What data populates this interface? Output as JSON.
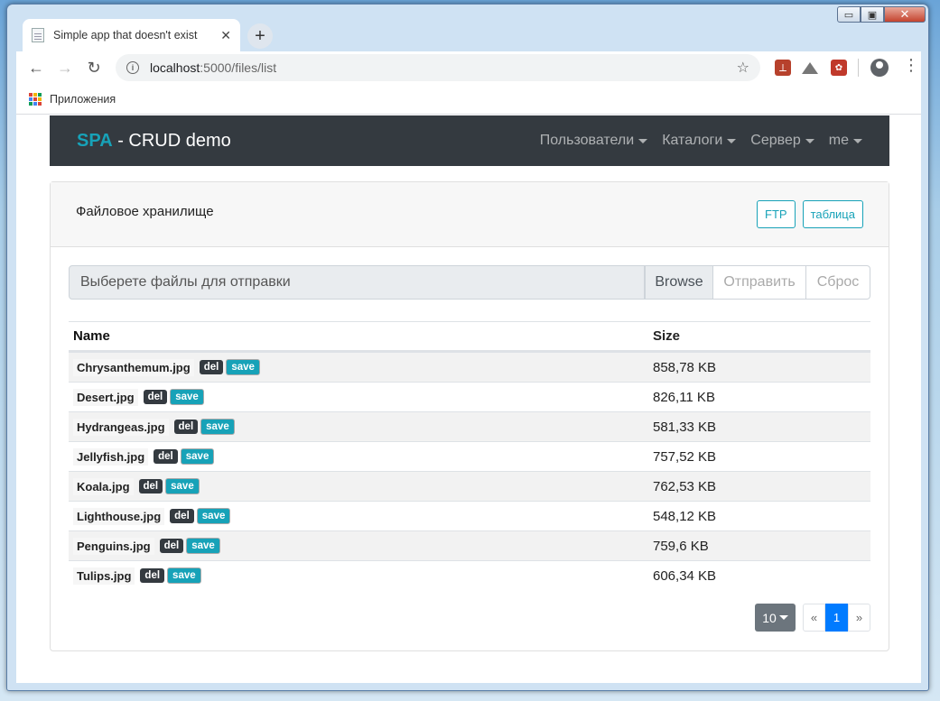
{
  "browser": {
    "tab_title": "Simple app that doesn't exist",
    "tab_close": "✕",
    "new_tab": "+",
    "url_host": "localhost",
    "url_path": ":5000/files/list",
    "bookmarks_apps": "Приложения"
  },
  "window": {
    "minimize": "▭",
    "maximize": "▣",
    "close": "✕"
  },
  "navbar": {
    "brand_spa": "SPA",
    "brand_rest": " - CRUD demo",
    "items": [
      "Пользователи",
      "Каталоги",
      "Сервер",
      "me"
    ]
  },
  "card": {
    "title": "Файловое хранилище",
    "ftp_button": "FTP",
    "table_button": "таблица"
  },
  "upload": {
    "placeholder": "Выберете файлы для отправки",
    "browse": "Browse",
    "send": "Отправить",
    "reset": "Сброс"
  },
  "table": {
    "headers": [
      "Name",
      "Size"
    ],
    "del_label": "del",
    "save_label": "save",
    "rows": [
      {
        "name": "Chrysanthemum.jpg",
        "size": "858,78 KB"
      },
      {
        "name": "Desert.jpg",
        "size": "826,11 KB"
      },
      {
        "name": "Hydrangeas.jpg",
        "size": "581,33 KB"
      },
      {
        "name": "Jellyfish.jpg",
        "size": "757,52 KB"
      },
      {
        "name": "Koala.jpg",
        "size": "762,53 KB"
      },
      {
        "name": "Lighthouse.jpg",
        "size": "548,12 KB"
      },
      {
        "name": "Penguins.jpg",
        "size": "759,6 KB"
      },
      {
        "name": "Tulips.jpg",
        "size": "606,34 KB"
      }
    ]
  },
  "pagination": {
    "page_size": "10",
    "prev": "«",
    "current": "1",
    "next": "»"
  },
  "colors": {
    "navbar_bg": "#343a40",
    "brand_accent": "#17a2b8",
    "active_page": "#007bff"
  }
}
